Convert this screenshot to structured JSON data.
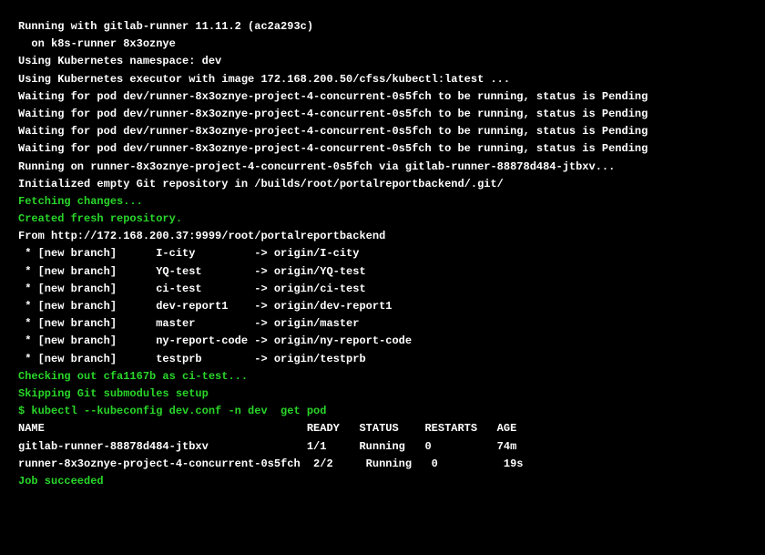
{
  "lines": [
    {
      "cls": "white",
      "text": "Running with gitlab-runner 11.11.2 (ac2a293c)"
    },
    {
      "cls": "white",
      "text": "  on k8s-runner 8x3oznye"
    },
    {
      "cls": "white",
      "text": "Using Kubernetes namespace: dev"
    },
    {
      "cls": "white",
      "text": "Using Kubernetes executor with image 172.168.200.50/cfss/kubectl:latest ..."
    },
    {
      "cls": "white",
      "text": "Waiting for pod dev/runner-8x3oznye-project-4-concurrent-0s5fch to be running, status is Pending"
    },
    {
      "cls": "white",
      "text": "Waiting for pod dev/runner-8x3oznye-project-4-concurrent-0s5fch to be running, status is Pending"
    },
    {
      "cls": "white",
      "text": "Waiting for pod dev/runner-8x3oznye-project-4-concurrent-0s5fch to be running, status is Pending"
    },
    {
      "cls": "white",
      "text": "Waiting for pod dev/runner-8x3oznye-project-4-concurrent-0s5fch to be running, status is Pending"
    },
    {
      "cls": "white",
      "text": "Running on runner-8x3oznye-project-4-concurrent-0s5fch via gitlab-runner-88878d484-jtbxv..."
    },
    {
      "cls": "white",
      "text": "Initialized empty Git repository in /builds/root/portalreportbackend/.git/"
    },
    {
      "cls": "green",
      "text": "Fetching changes..."
    },
    {
      "cls": "green",
      "text": "Created fresh repository."
    },
    {
      "cls": "white",
      "text": "From http://172.168.200.37:9999/root/portalreportbackend"
    },
    {
      "cls": "white",
      "text": " * [new branch]      I-city         -> origin/I-city"
    },
    {
      "cls": "white",
      "text": " * [new branch]      YQ-test        -> origin/YQ-test"
    },
    {
      "cls": "white",
      "text": " * [new branch]      ci-test        -> origin/ci-test"
    },
    {
      "cls": "white",
      "text": " * [new branch]      dev-report1    -> origin/dev-report1"
    },
    {
      "cls": "white",
      "text": " * [new branch]      master         -> origin/master"
    },
    {
      "cls": "white",
      "text": " * [new branch]      ny-report-code -> origin/ny-report-code"
    },
    {
      "cls": "white",
      "text": " * [new branch]      testprb        -> origin/testprb"
    },
    {
      "cls": "green",
      "text": "Checking out cfa1167b as ci-test..."
    },
    {
      "cls": "white",
      "text": ""
    },
    {
      "cls": "green",
      "text": "Skipping Git submodules setup"
    },
    {
      "cls": "green",
      "text": "$ kubectl --kubeconfig dev.conf -n dev  get pod"
    },
    {
      "cls": "white",
      "text": "NAME                                        READY   STATUS    RESTARTS   AGE"
    },
    {
      "cls": "white",
      "text": "gitlab-runner-88878d484-jtbxv               1/1     Running   0          74m"
    },
    {
      "cls": "white",
      "text": "runner-8x3oznye-project-4-concurrent-0s5fch  2/2     Running   0          19s"
    },
    {
      "cls": "green",
      "text": "Job succeeded"
    }
  ]
}
